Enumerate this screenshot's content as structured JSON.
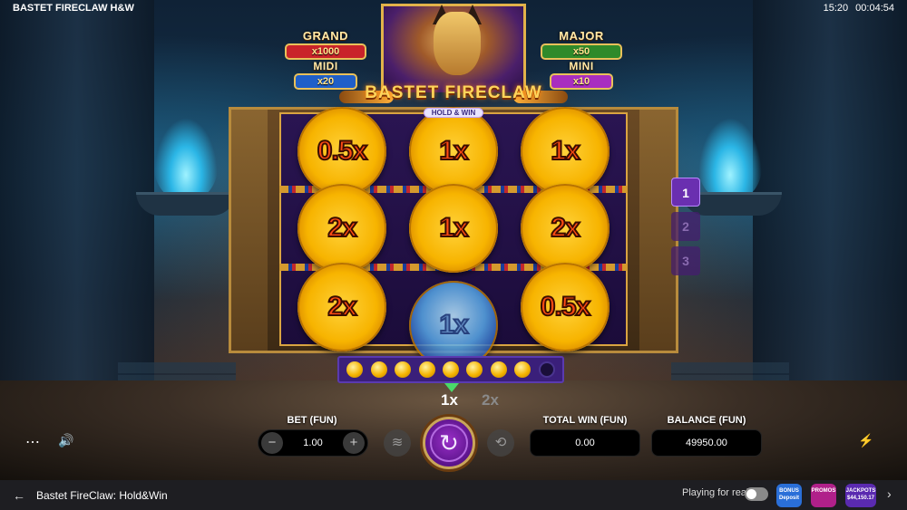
{
  "window": {
    "title": "BASTET FIRECLAW H&W",
    "clock": "15:20",
    "session_time": "00:04:54"
  },
  "jackpots": {
    "grand": {
      "name": "GRAND",
      "value": "x1000",
      "color": "#c9232a"
    },
    "major": {
      "name": "MAJOR",
      "value": "x50",
      "color": "#2f8a2a"
    },
    "midi": {
      "name": "MIDI",
      "value": "x20",
      "color": "#1f5fc8"
    },
    "mini": {
      "name": "MINI",
      "value": "x10",
      "color": "#a82ec0"
    }
  },
  "logo": {
    "title": "BASTET FIRECLAW",
    "subtitle": "HOLD & WIN"
  },
  "reels": {
    "cells": [
      {
        "value": "0.5x",
        "state": "coin"
      },
      {
        "value": "1x",
        "state": "coin"
      },
      {
        "value": "1x",
        "state": "coin"
      },
      {
        "value": "2x",
        "state": "coin"
      },
      {
        "value": "1x",
        "state": "coin"
      },
      {
        "value": "2x",
        "state": "coin"
      },
      {
        "value": "2x",
        "state": "coin"
      },
      {
        "value": "1x",
        "state": "spinning"
      },
      {
        "value": "0.5x",
        "state": "coin"
      }
    ]
  },
  "reel_selector": {
    "items": [
      "1",
      "2",
      "3"
    ],
    "active": "1"
  },
  "progress": {
    "filled": 8,
    "total": 9
  },
  "multiplier": {
    "current": "1x",
    "next": "2x"
  },
  "controls": {
    "bet_label": "BET (FUN)",
    "bet_value": "1.00",
    "minus": "−",
    "plus": "+",
    "total_win_label": "TOTAL WIN (FUN)",
    "total_win_value": "0.00",
    "balance_label": "BALANCE (FUN)",
    "balance_value": "49950.00",
    "menu_icon": "⋯",
    "sound_icon": "🔊",
    "stack_icon": "≋",
    "spin_icon": "↻",
    "autoplay_icon": "⟲",
    "turbo_icon": "⚡"
  },
  "footer": {
    "back_icon": "←",
    "game_title": "Bastet FireClaw: Hold&Win",
    "playing_for_real": "Playing for real",
    "promos": [
      {
        "label": "BONUS Deposit",
        "color": "#2a6fd8"
      },
      {
        "label": "PROMOS",
        "color": "#b0208a"
      },
      {
        "label": "JACKPOTS $44,150.17",
        "color": "#5a2ab0"
      }
    ],
    "chevron": "›"
  }
}
